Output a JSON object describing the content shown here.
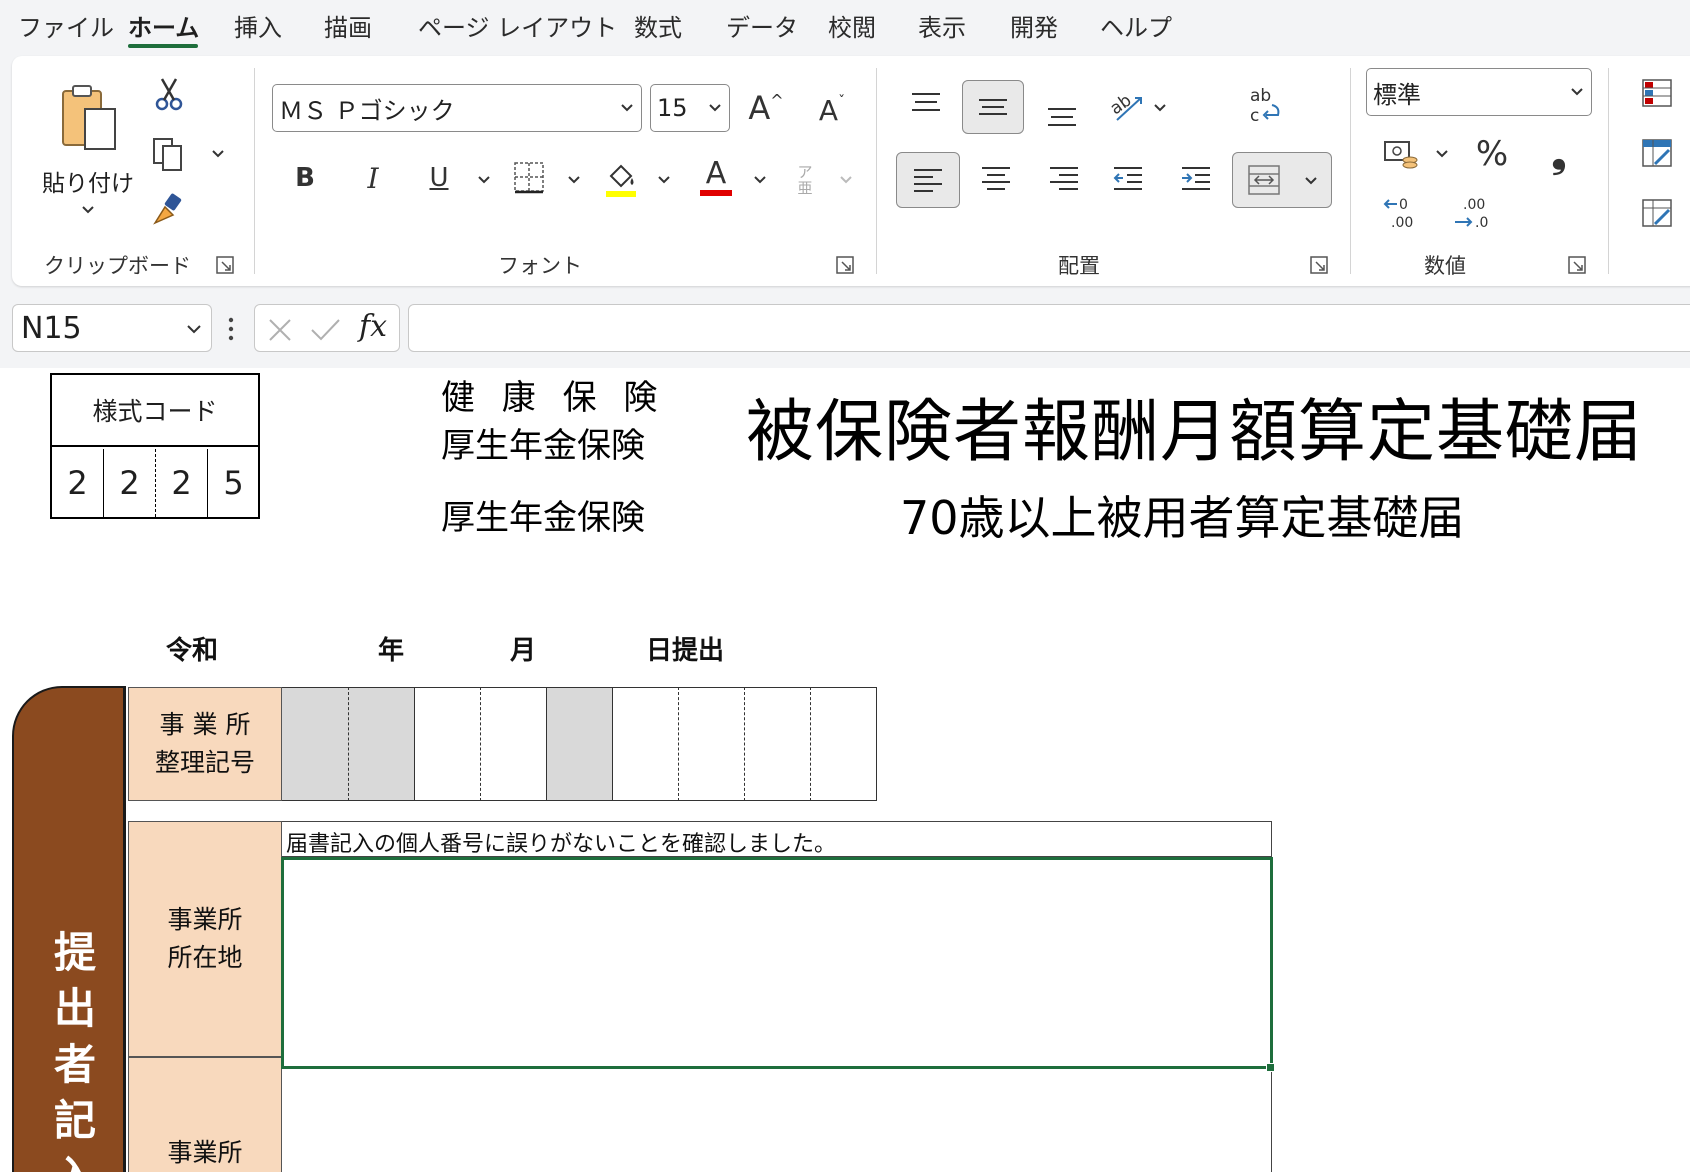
{
  "menu": {
    "tabs": [
      "ファイル",
      "ホーム",
      "挿入",
      "描画",
      "ページ レイアウト",
      "数式",
      "データ",
      "校閲",
      "表示",
      "開発",
      "ヘルプ"
    ],
    "active_tab": "ホーム"
  },
  "ribbon": {
    "clipboard": {
      "label": "クリップボード",
      "paste_label": "貼り付け"
    },
    "font": {
      "label": "フォント",
      "font_name": "ＭＳ Ｐゴシック",
      "font_size": "15",
      "bold": "B",
      "italic": "I",
      "underline": "U",
      "font_color_glyph": "A",
      "furigana_glyph": "ア亜"
    },
    "alignment": {
      "label": "配置"
    },
    "number": {
      "label": "数値",
      "format": "標準",
      "percent": "%",
      "comma": "❟"
    },
    "colors": {
      "accent": "#1e6e3c",
      "highlight": "#ffff00",
      "font_color": "#e00000"
    }
  },
  "formula_bar": {
    "name_box": "N15",
    "fx": "fx",
    "formula": ""
  },
  "sheet": {
    "code_box": {
      "header": "様式コード",
      "digits": [
        "2",
        "2",
        "2",
        "5"
      ]
    },
    "insurance": {
      "line1": "健 康 保 険",
      "line2": "厚生年金保険",
      "line3": "厚生年金保険"
    },
    "title": "被保険者報酬月額算定基礎届",
    "subtitle": "70歳以上被用者算定基礎届",
    "date": {
      "era": "令和",
      "year": "年",
      "month": "月",
      "day": "日提出"
    },
    "side_label": "提出者記入",
    "office_code": {
      "line1": "事 業 所",
      "line2": "整理記号"
    },
    "office_address": {
      "line1": "事業所",
      "line2": "所在地"
    },
    "office_name": {
      "line1": "事業所"
    },
    "address_note": "届書記入の個人番号に誤りがないことを確認しました。",
    "colors": {
      "side_bar": "#8b4a1f",
      "label_fill": "#f8d9bd",
      "gray_fill": "#d9d9d9"
    }
  }
}
